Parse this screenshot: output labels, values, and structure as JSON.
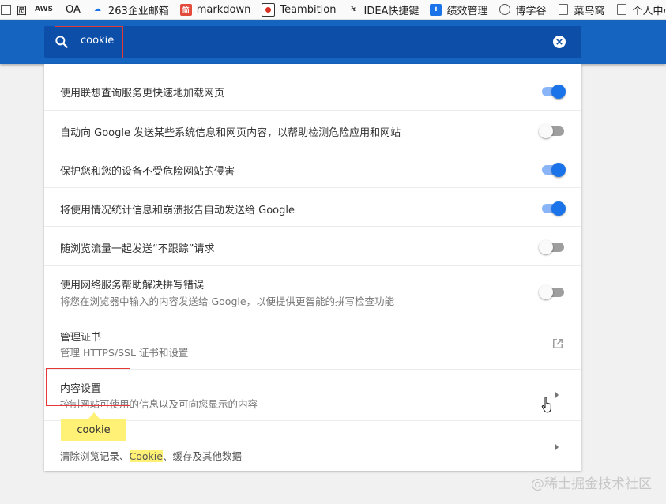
{
  "bookmarks": [
    {
      "label": "圆",
      "icon": "page-icon"
    },
    {
      "label": "",
      "icon": "aws-icon"
    },
    {
      "label": "OA",
      "icon": ""
    },
    {
      "label": "263企业邮箱",
      "icon": "cloud-icon"
    },
    {
      "label": "markdown",
      "icon": "jianshu-icon"
    },
    {
      "label": "Teambition",
      "icon": "teambition-icon"
    },
    {
      "label": "IDEA快捷键",
      "icon": "idea-icon"
    },
    {
      "label": "绩效管理",
      "icon": "info-icon"
    },
    {
      "label": "博学谷",
      "icon": "circle-icon"
    },
    {
      "label": "菜鸟窝",
      "icon": "page-icon"
    },
    {
      "label": "个人中心",
      "icon": "page-icon"
    }
  ],
  "search": {
    "query": "cookie"
  },
  "rows": [
    {
      "title": "使用联想查询服务更快速地加载网页",
      "toggle": "on"
    },
    {
      "title": "自动向 Google 发送某些系统信息和网页内容，以帮助检测危险应用和网站",
      "toggle": "off"
    },
    {
      "title": "保护您和您的设备不受危险网站的侵害",
      "toggle": "on"
    },
    {
      "title": "将使用情况统计信息和崩溃报告自动发送给 Google",
      "toggle": "on"
    },
    {
      "title": "随浏览流量一起发送“不跟踪”请求",
      "toggle": "off"
    },
    {
      "title": "使用网络服务帮助解决拼写错误",
      "subtitle": "将您在浏览器中输入的内容发送给 Google，以便提供更智能的拼写检查功能",
      "toggle": "off"
    },
    {
      "title": "管理证书",
      "subtitle": "管理 HTTPS/SSL 证书和设置"
    },
    {
      "title": "内容设置",
      "subtitle": "控制网站可使用的信息以及可向您显示的内容"
    },
    {
      "subtitle_pre": "清除浏览记录、",
      "subtitle_mark": "Cookie",
      "subtitle_post": "、缓存及其他数据"
    }
  ],
  "tooltip": "cookie",
  "watermark": "@稀土掘金技术社区",
  "colors": {
    "header": "#1565c0",
    "toggle_on": "#1a73e8",
    "highlight": "#fff176",
    "annotation": "#e53935"
  }
}
